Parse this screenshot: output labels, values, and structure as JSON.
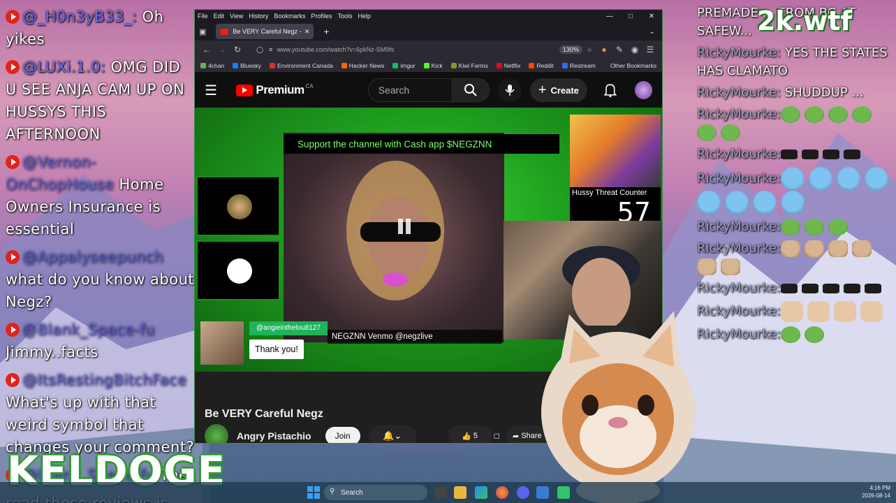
{
  "left_chat": [
    {
      "user": "@_H0n3yB33_:",
      "text": " Oh yikes",
      "blur": false
    },
    {
      "user": "@LUXi.1.0:",
      "text": " OMG DID U SEE ANJA CAM UP ON HUSSYS THIS AFTERNOON",
      "blur": false
    },
    {
      "user": "@Vernon-OnChopHouse",
      "text": " Home Owners Insurance is essential",
      "blur": true
    },
    {
      "user": "@Appalyseepunch",
      "text": " what do you know about Negz?",
      "blur": true
    },
    {
      "user": "@Blank_Space-fu",
      "text": " Jimmy..facts",
      "blur": true
    },
    {
      "user": "@ItsRestingBitchFace",
      "text": " What's up with that weird symbol that changes your comment?",
      "blur": true
    },
    {
      "user": "@Blank_Space-fu",
      "text": " The",
      "blur": true
    }
  ],
  "left_chat_tail": "read those reviews is",
  "right_chat": [
    {
      "user": "",
      "text": "PREMADE ... FROM BC AT SAFEW...",
      "emotes": []
    },
    {
      "user": "RickyMourke:",
      "text": " YES THE STATES HAS CLAMATO",
      "emotes": []
    },
    {
      "user": "RickyMourke:",
      "text": " SHUDDUP ...",
      "emotes": []
    },
    {
      "user": "RickyMourke:",
      "text": "",
      "emotes": [
        "pepe",
        "pepe",
        "pepe",
        "pepe",
        "pepe",
        "pepe"
      ]
    },
    {
      "user": "RickyMourke:",
      "text": "",
      "emotes": [
        "black",
        "black",
        "black",
        "black"
      ]
    },
    {
      "user": "RickyMourke:",
      "text": "",
      "emotes": [
        "blue",
        "blue",
        "blue",
        "blue",
        "blue",
        "blue",
        "blue",
        "blue"
      ]
    },
    {
      "user": "RickyMourke:",
      "text": "",
      "emotes": [
        "pepe",
        "pepe",
        "pepe"
      ]
    },
    {
      "user": "RickyMourke:",
      "text": "",
      "emotes": [
        "cat",
        "cat",
        "cat",
        "cat",
        "cat",
        "cat"
      ]
    },
    {
      "user": "RickyMourke:",
      "text": "",
      "emotes": [
        "black",
        "black",
        "black",
        "black",
        "black"
      ]
    },
    {
      "user": "RickyMourke:",
      "text": "",
      "emotes": [
        "hand",
        "hand",
        "hand",
        "hand"
      ]
    },
    {
      "user": "RickyMourke:",
      "text": "",
      "emotes": [
        "pepe",
        "pepe"
      ]
    }
  ],
  "overlay_logo_top": "2k.wtf",
  "overlay_logo_bottom": "KELDOGE",
  "browser": {
    "menu": [
      "File",
      "Edit",
      "View",
      "History",
      "Bookmarks",
      "Profiles",
      "Tools",
      "Help"
    ],
    "tab_title": "Be VERY Careful Negz - You",
    "url": "www.youtube.com/watch?v=6pkNz-SM9fs",
    "zoom": "130%",
    "bookmarks": [
      {
        "label": "4chan",
        "color": "#6ab04c"
      },
      {
        "label": "Bluesky",
        "color": "#1185fe"
      },
      {
        "label": "Environment Canada",
        "color": "#d63031"
      },
      {
        "label": "Hacker News",
        "color": "#ff6600"
      },
      {
        "label": "imgur",
        "color": "#1bb76e"
      },
      {
        "label": "Kick",
        "color": "#53fc18"
      },
      {
        "label": "Kiwi Farms",
        "color": "#7c9a2d"
      },
      {
        "label": "Netflix",
        "color": "#e50914"
      },
      {
        "label": "Reddit",
        "color": "#ff4500"
      },
      {
        "label": "Restream",
        "color": "#2b6ef5"
      }
    ],
    "other_bookmarks": "Other Bookmarks"
  },
  "youtube": {
    "logo": "Premium",
    "region": "CA",
    "search_placeholder": "Search",
    "create_label": "Create",
    "video": {
      "support_banner": "Support the channel with Cash app $NEGZNN",
      "venmo_banner": "NEGZNN Venmo @negzlive",
      "threat_label": "Hussy Threat Counter",
      "threat_count": "57",
      "donor_name": "@angieinthelou8127",
      "donor_message": "Thank you!"
    },
    "title": "Be VERY Careful Negz",
    "channel": "Angry Pistachio",
    "join_label": "Join",
    "like_count": "5",
    "share_label": "Share"
  },
  "taskbar": {
    "search": "Search",
    "time": "4:16 PM",
    "date": "2026-08-14"
  }
}
